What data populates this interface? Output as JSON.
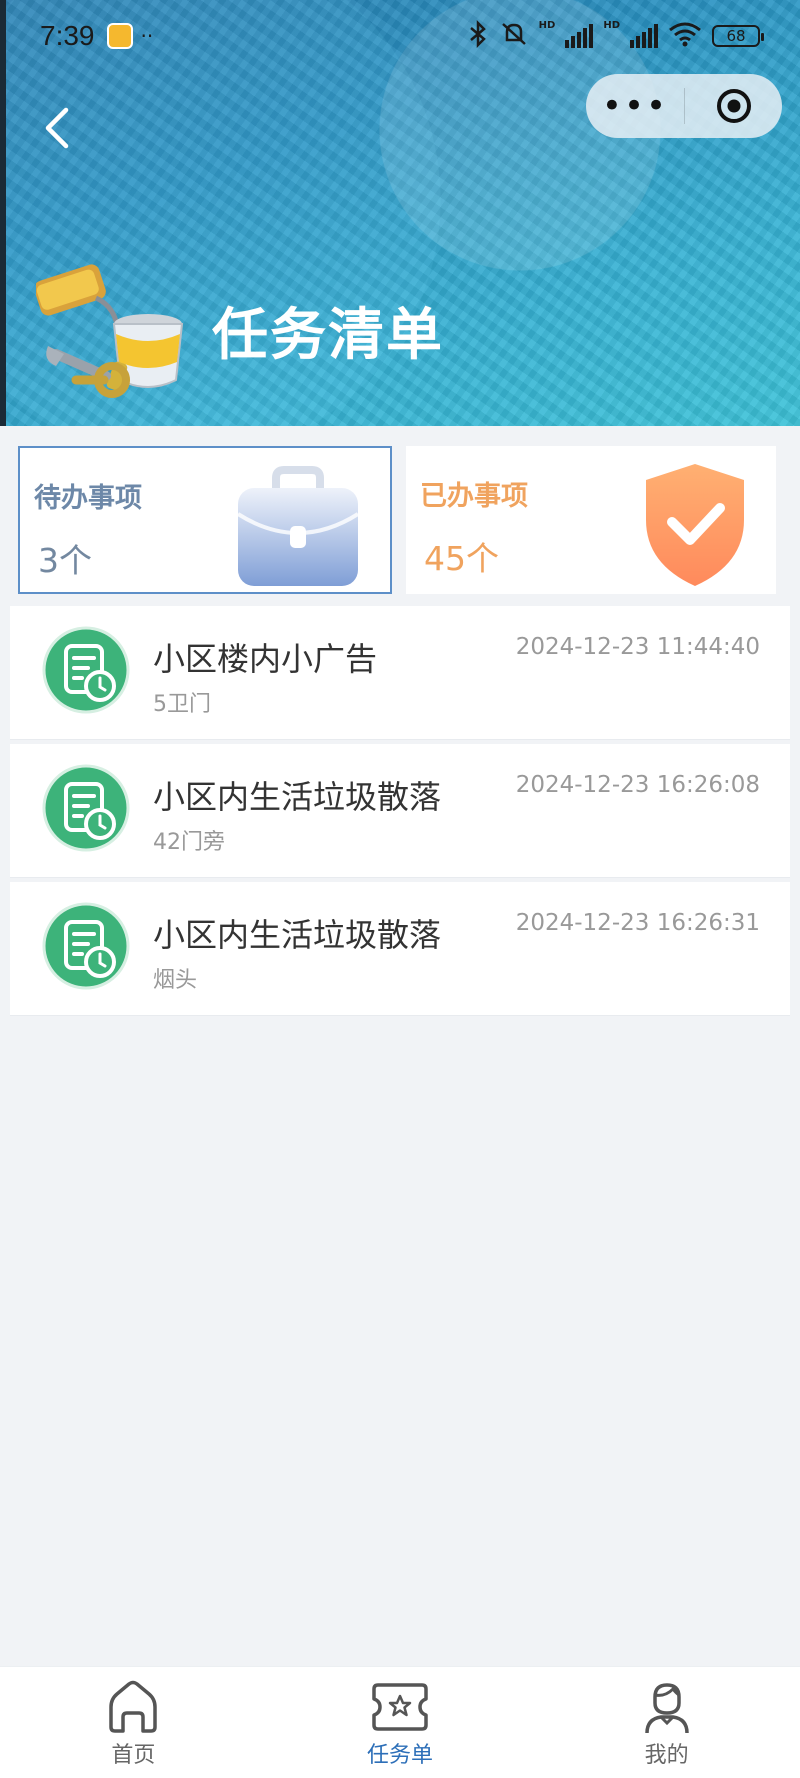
{
  "status_bar": {
    "time": "7:39",
    "dots": "··",
    "hd1": "HD",
    "hd2": "HD",
    "battery": "68"
  },
  "header": {
    "title": "任务清单",
    "capsule_more": "•••"
  },
  "summary": {
    "pending": {
      "label": "待办事项",
      "count": "3个"
    },
    "done": {
      "label": "已办事项",
      "count": "45个"
    }
  },
  "tasks": [
    {
      "title": "小区楼内小广告",
      "location": "5卫门",
      "time": "2024-12-23 11:44:40"
    },
    {
      "title": "小区内生活垃圾散落",
      "location": "42门旁",
      "time": "2024-12-23 16:26:08"
    },
    {
      "title": "小区内生活垃圾散落",
      "location": "烟头",
      "time": "2024-12-23 16:26:31"
    }
  ],
  "tabbar": {
    "items": [
      {
        "label": "首页",
        "icon": "home-icon"
      },
      {
        "label": "任务单",
        "icon": "task-list-icon",
        "active": true
      },
      {
        "label": "我的",
        "icon": "user-icon"
      }
    ]
  },
  "colors": {
    "accent": "#2d6fb8",
    "pending": "#6d88a8",
    "done": "#f0a35e",
    "task_icon": "#3db37a"
  }
}
